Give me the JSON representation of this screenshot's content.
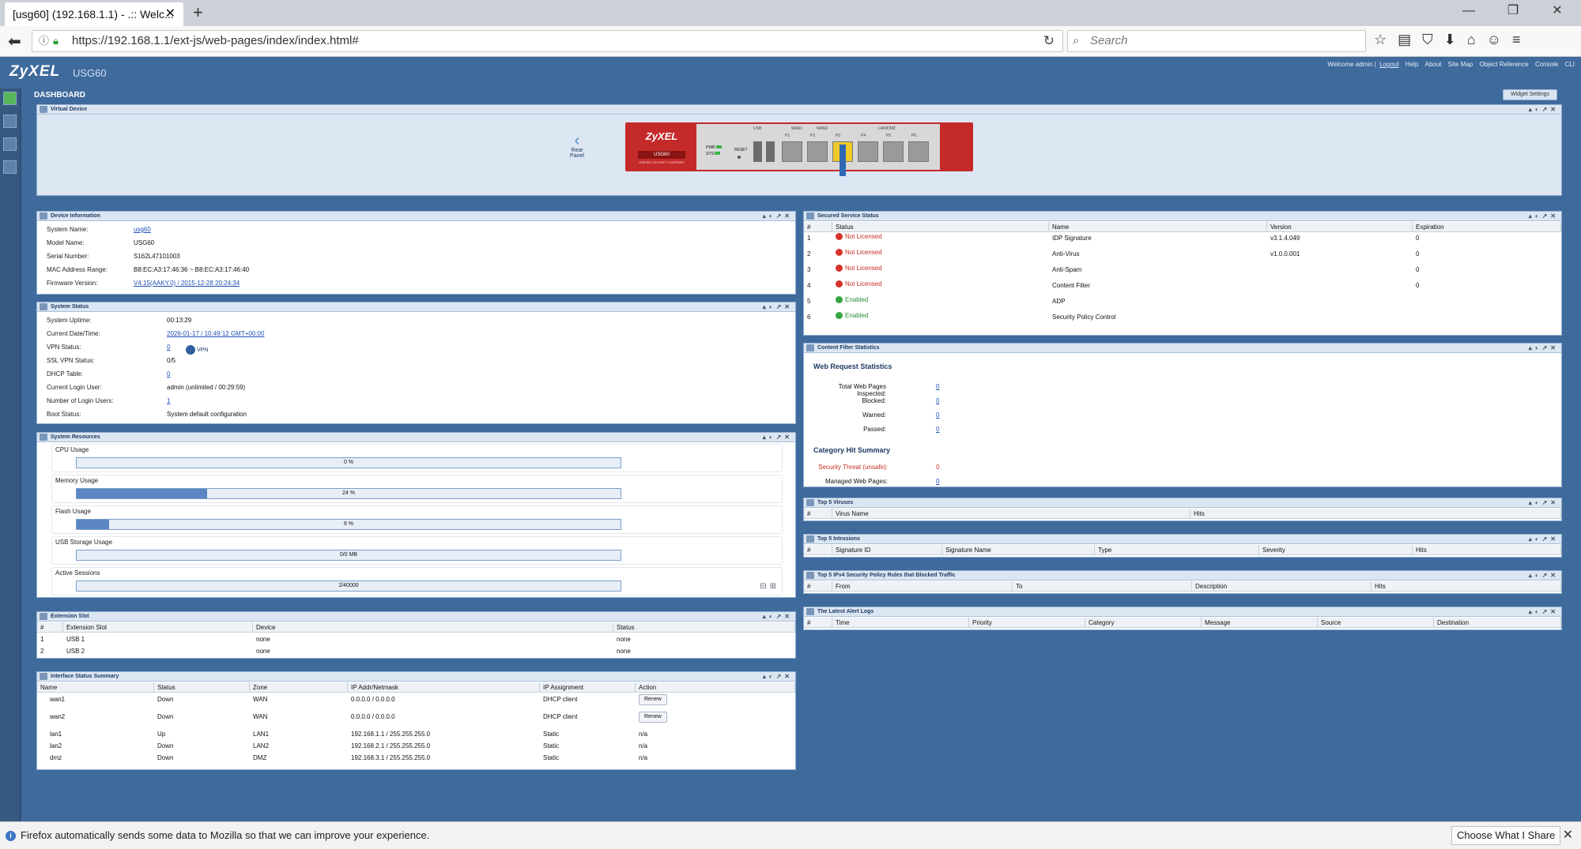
{
  "browser": {
    "tab_title": "[usg60] (192.168.1.1) - .:: Welc...",
    "url": "https://192.168.1.1/ext-js/web-pages/index/index.html#",
    "search_placeholder": "Search",
    "notification": "Firefox automatically sends some data to Mozilla so that we can improve your experience.",
    "notification_button": "Choose What I Share"
  },
  "app": {
    "brand": "ZyXEL",
    "model": "USG60",
    "welcome": "Welcome admin |",
    "logout": "Logout",
    "links": [
      "Help",
      "About",
      "Site Map",
      "Object Reference",
      "Console",
      "CLI"
    ],
    "dashboard_label": "DASHBOARD",
    "widget_settings": "Widget Settings"
  },
  "virtual_device": {
    "title": "Virtual Device",
    "rear_panel": "Rear Panel",
    "device_brand": "ZyXEL",
    "device_model": "USG60",
    "device_subtitle": "UNIFIED SECURITY GATEWAY",
    "leds": [
      "PWR",
      "SYS"
    ],
    "reset": "RESET",
    "port_groups": [
      "USB",
      "WAN1",
      "WAN2",
      "LAN/DMZ"
    ],
    "ports": [
      "P1",
      "P2",
      "P3",
      "P4",
      "P5",
      "P6"
    ]
  },
  "device_info": {
    "title": "Device Information",
    "rows": [
      {
        "label": "System Name:",
        "value": "usg60",
        "link": true
      },
      {
        "label": "Model Name:",
        "value": "USG60",
        "link": false
      },
      {
        "label": "Serial Number:",
        "value": "S162L47101003",
        "link": false
      },
      {
        "label": "MAC Address Range:",
        "value": "B8:EC:A3:17:46:36 ~ B8:EC:A3:17:46:40",
        "link": false
      },
      {
        "label": "Firmware Version:",
        "value": "V4.15(AAKY.0) / 2015-12-28 20:24:34",
        "link": true
      }
    ]
  },
  "system_status": {
    "title": "System Status",
    "rows": [
      {
        "label": "System Uptime:",
        "value": "00:13:29",
        "link": false
      },
      {
        "label": "Current Date/Time:",
        "value": "2026-01-17 / 10:49:12 GMT+00:00",
        "link": true
      },
      {
        "label": "VPN Status:",
        "value": "0",
        "link": true
      },
      {
        "label": "SSL VPN Status:",
        "value": "0/5",
        "link": false
      },
      {
        "label": "DHCP Table:",
        "value": "0",
        "link": true
      },
      {
        "label": "Current Login User:",
        "value": "admin (unlimited / 00:29:59)",
        "link": false
      },
      {
        "label": "Number of Login Users:",
        "value": "1",
        "link": true
      },
      {
        "label": "Boot Status:",
        "value": "System default configuration",
        "link": false
      }
    ],
    "vpn_badge": "VPN"
  },
  "system_resources": {
    "title": "System Resources",
    "items": [
      {
        "label": "CPU Usage",
        "text": "0 %",
        "fraction": 0.0
      },
      {
        "label": "Memory Usage",
        "text": "24 %",
        "fraction": 0.24
      },
      {
        "label": "Flash Usage",
        "text": "6 %",
        "fraction": 0.06
      },
      {
        "label": "USB Storage Usage",
        "text": "0/0 MB",
        "fraction": 0.0
      },
      {
        "label": "Active Sessions",
        "text": "2/40000",
        "fraction": 0.0
      }
    ]
  },
  "extension_slot": {
    "title": "Extension Slot",
    "columns": [
      "#",
      "Extension Slot",
      "Device",
      "Status"
    ],
    "rows": [
      [
        "1",
        "USB 1",
        "none",
        "none"
      ],
      [
        "2",
        "USB 2",
        "none",
        "none"
      ]
    ]
  },
  "interface_status": {
    "title": "Interface Status Summary",
    "columns": [
      "Name",
      "Status",
      "Zone",
      "IP Addr/Netmask",
      "IP Assignment",
      "Action"
    ],
    "rows": [
      [
        "wan1",
        "Down",
        "WAN",
        "0.0.0.0 / 0.0.0.0",
        "DHCP client",
        "Renew"
      ],
      [
        "wan2",
        "Down",
        "WAN",
        "0.0.0.0 / 0.0.0.0",
        "DHCP client",
        "Renew"
      ],
      [
        "lan1",
        "Up",
        "LAN1",
        "192.168.1.1 / 255.255.255.0",
        "Static",
        "n/a"
      ],
      [
        "lan2",
        "Down",
        "LAN2",
        "192.168.2.1 / 255.255.255.0",
        "Static",
        "n/a"
      ],
      [
        "dmz",
        "Down",
        "DMZ",
        "192.168.3.1 / 255.255.255.0",
        "Static",
        "n/a"
      ]
    ]
  },
  "secured_service": {
    "title": "Secured Service Status",
    "columns": [
      "#",
      "Status",
      "Name",
      "Version",
      "Expiration"
    ],
    "rows": [
      {
        "n": "1",
        "status": "Not Licensed",
        "ok": false,
        "name": "IDP Signature",
        "version": "v3.1.4.049",
        "exp": "0"
      },
      {
        "n": "2",
        "status": "Not Licensed",
        "ok": false,
        "name": "Anti-Virus",
        "version": "v1.0.0.001",
        "exp": "0"
      },
      {
        "n": "3",
        "status": "Not Licensed",
        "ok": false,
        "name": "Anti-Spam",
        "version": "",
        "exp": "0"
      },
      {
        "n": "4",
        "status": "Not Licensed",
        "ok": false,
        "name": "Content Filter",
        "version": "",
        "exp": "0"
      },
      {
        "n": "5",
        "status": "Enabled",
        "ok": true,
        "name": "ADP",
        "version": "",
        "exp": ""
      },
      {
        "n": "6",
        "status": "Enabled",
        "ok": true,
        "name": "Security Policy Control",
        "version": "",
        "exp": ""
      }
    ]
  },
  "content_filter": {
    "title": "Content Filter Statistics",
    "web_heading": "Web Request Statistics",
    "web_rows": [
      {
        "label": "Total Web Pages Inspected:",
        "value": "0"
      },
      {
        "label": "Blocked:",
        "value": "0"
      },
      {
        "label": "Warned:",
        "value": "0"
      },
      {
        "label": "Passed:",
        "value": "0"
      }
    ],
    "cat_heading": "Category Hit Summary",
    "cat_rows": [
      {
        "label": "Security Threat (unsafe):",
        "value": "0",
        "red": true
      },
      {
        "label": "Managed Web Pages:",
        "value": "0",
        "red": false
      }
    ]
  },
  "top_viruses": {
    "title": "Top 5 Viruses",
    "columns": [
      "#",
      "Virus Name",
      "Hits"
    ]
  },
  "top_intrusions": {
    "title": "Top 5 Intrusions",
    "columns": [
      "#",
      "Signature ID",
      "Signature Name",
      "Type",
      "Severity",
      "Hits"
    ]
  },
  "top_policy": {
    "title": "Top 5 IPv4 Security Policy Rules that Blocked Traffic",
    "columns": [
      "#",
      "From",
      "To",
      "Description",
      "Hits"
    ]
  },
  "alert_logs": {
    "title": "The Latest Alert Logs",
    "columns": [
      "#",
      "Time",
      "Priority",
      "Category",
      "Message",
      "Source",
      "Destination"
    ]
  }
}
